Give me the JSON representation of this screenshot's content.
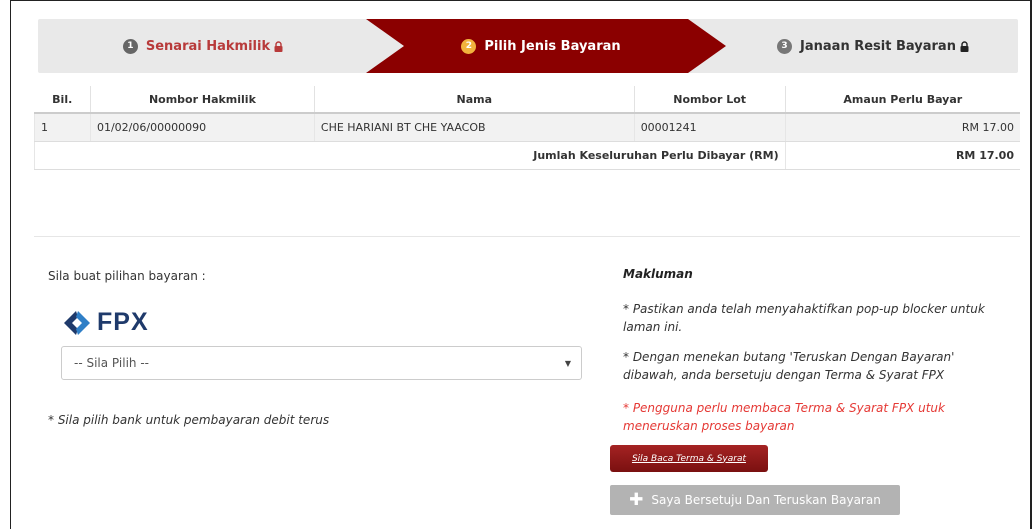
{
  "stepper": {
    "steps": [
      {
        "number": "1",
        "label": "Senarai Hakmilik",
        "locked": true,
        "state": "done"
      },
      {
        "number": "2",
        "label": "Pilih Jenis Bayaran",
        "locked": false,
        "state": "active"
      },
      {
        "number": "3",
        "label": "Janaan Resit Bayaran",
        "locked": true,
        "state": "pending"
      }
    ],
    "active_color": "#8b0000"
  },
  "table": {
    "headers": [
      "Bil.",
      "Nombor Hakmilik",
      "Nama",
      "Nombor Lot",
      "Amaun Perlu Bayar"
    ],
    "rows": [
      {
        "bil": "1",
        "hakmilik": "01/02/06/00000090",
        "nama": "CHE HARIANI BT CHE YAACOB",
        "lot": "00001241",
        "amaun": "RM 17.00"
      }
    ],
    "total_label": "Jumlah Keseluruhan Perlu Dibayar (RM)",
    "total_value": "RM 17.00"
  },
  "payment": {
    "prompt": "Sila buat pilihan bayaran :",
    "logo_text": "FPX",
    "bank_select_value": "-- Sila Pilih --",
    "bank_note": "* Sila pilih bank untuk pembayaran debit terus"
  },
  "info": {
    "title": "Makluman",
    "p1": "* Pastikan anda telah menyahaktifkan pop-up blocker untuk laman ini.",
    "p2": "* Dengan menekan butang 'Teruskan Dengan Bayaran' dibawah, anda bersetuju dengan Terma & Syarat FPX",
    "p3": "* Pengguna perlu membaca Terma & Syarat FPX utuk meneruskan proses bayaran",
    "terms_button": "Sila Baca Terma & Syarat",
    "agree_button": "Saya Bersetuju Dan Teruskan Bayaran",
    "warning_color": "#e53935"
  }
}
